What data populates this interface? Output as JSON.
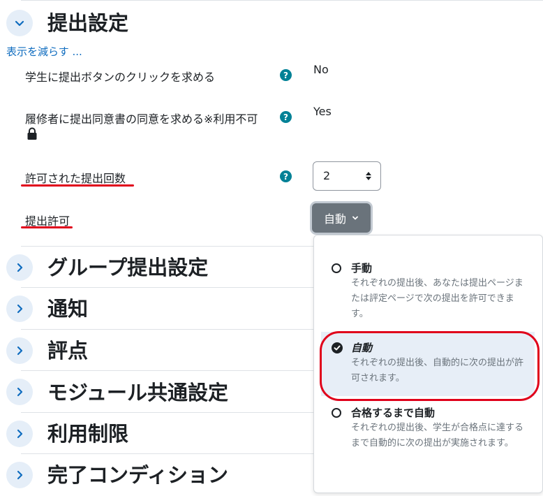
{
  "section": {
    "title": "提出設定",
    "show_less": "表示を減らす ..."
  },
  "settings": [
    {
      "label": "学生に提出ボタンのクリックを求める",
      "value": "No"
    },
    {
      "label": "履修者に提出同意書の同意を求める※利用不可",
      "value": "Yes"
    },
    {
      "label": "許可された提出回数",
      "value": "2"
    },
    {
      "label": "提出許可",
      "value": "自動"
    }
  ],
  "help_glyph": "?",
  "dropdown": {
    "options": [
      {
        "title": "手動",
        "desc": "それぞれの提出後、あなたは提出ページまたは評定ページで次の提出を許可できます。"
      },
      {
        "title": "自動",
        "desc": "それぞれの提出後、自動的に次の提出が許可されます。"
      },
      {
        "title": "合格するまで自動",
        "desc": "それぞれの提出後、学生が合格点に達するまで自動的に次の提出が実施されます。"
      }
    ],
    "selected_index": 1
  },
  "collapsed_sections": [
    "グループ提出設定",
    "通知",
    "評点",
    "モジュール共通設定",
    "利用制限",
    "完了コンディション"
  ],
  "colors": {
    "link": "#0f6cbf",
    "help": "#008196",
    "annotation_red": "#e0001b",
    "selected_bg": "#e7eef7"
  }
}
